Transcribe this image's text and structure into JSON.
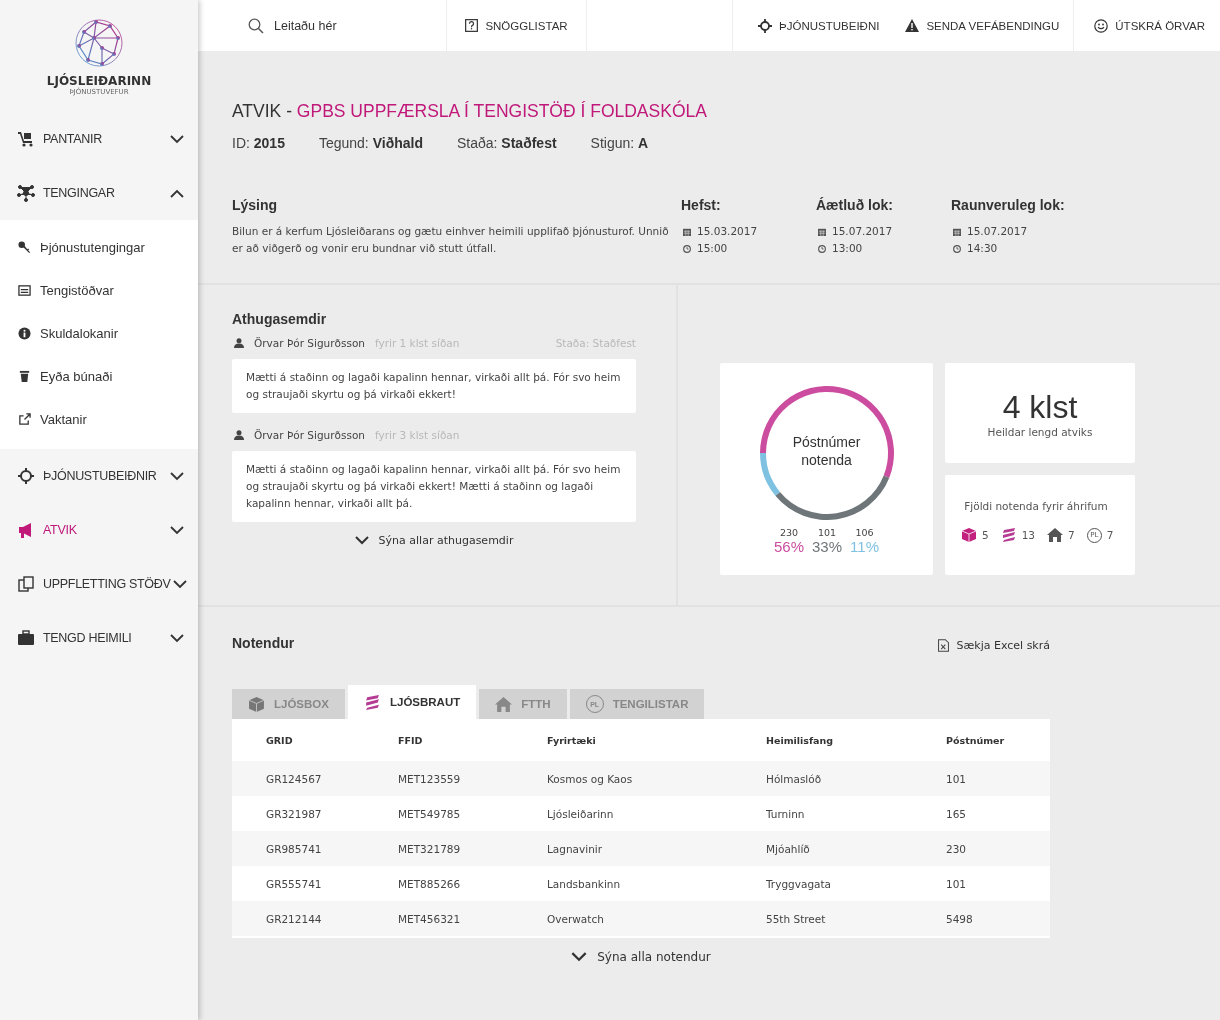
{
  "brand": {
    "name": "LJÓSLEIÐARINN",
    "subtitle": "ÞJÓNUSTUVEFUR"
  },
  "sidebar": {
    "items": [
      {
        "label": "PANTANIR",
        "expanded": false,
        "selected": false
      },
      {
        "label": "TENGINGAR",
        "expanded": true,
        "selected": false,
        "children": [
          {
            "label": "Þjónustutengingar"
          },
          {
            "label": "Tengistöðvar"
          },
          {
            "label": "Skuldalokanir"
          },
          {
            "label": "Eyða búnaði"
          },
          {
            "label": "Vaktanir"
          }
        ]
      },
      {
        "label": "ÞJÓNUSTUBEIÐNIR",
        "expanded": false,
        "selected": false
      },
      {
        "label": "ATVIK",
        "expanded": false,
        "selected": true
      },
      {
        "label": "UPPFLETTING STÖÐV",
        "expanded": false,
        "selected": false
      },
      {
        "label": "TENGD HEIMILI",
        "expanded": false,
        "selected": false
      }
    ]
  },
  "topbar": {
    "search": {
      "placeholder": "Leitaðu hér"
    },
    "quick": "SNÖGGLISTAR",
    "actions": [
      "ÞJÓNUSTUBEIÐNI",
      "SENDA VEFÁBENDINGU"
    ],
    "logout": "ÚTSKRÁ ÖRVAR"
  },
  "incident": {
    "prefix": "ATVIK -",
    "title": "GPBS UPPFÆRSLA Í TENGISTÖÐ Í FOLDASKÓLA",
    "meta": [
      {
        "label": "ID:",
        "value": "2015"
      },
      {
        "label": "Tegund:",
        "value": "Viðhald"
      },
      {
        "label": "Staða:",
        "value": "Staðfest"
      },
      {
        "label": "Stigun:",
        "value": "A"
      }
    ],
    "description": {
      "heading": "Lýsing",
      "text": "Bilun er á kerfum Ljósleiðarans og gætu einhver heimili upplifað þjónusturof. Unnið er að viðgerð og vonir eru bundnar við stutt útfall."
    },
    "dates": [
      {
        "heading": "Hefst:",
        "date": "15.03.2017",
        "time": "15:00"
      },
      {
        "heading": "Áætluð lok:",
        "date": "15.07.2017",
        "time": "13:00"
      },
      {
        "heading": "Raunveruleg lok:",
        "date": "15.07.2017",
        "time": "14:30"
      }
    ]
  },
  "comments": {
    "heading": "Athugasemdir",
    "items": [
      {
        "author": "Örvar Þór Sigurðsson",
        "time": "fyrir 1 klst síðan",
        "status": "Staða: Staðfest",
        "text": "Mætti á staðinn og lagaði kapalinn hennar, virkaði allt þá. Fór svo heim og straujaði skyrtu og þá virkaði ekkert!"
      },
      {
        "author": "Örvar Þór Sigurðsson",
        "time": "fyrir 3 klst síðan",
        "text": "Mætti á staðinn og lagaði kapalinn hennar, virkaði allt þá. Fór svo heim og straujaði skyrtu og þá virkaði ekkert! Mætti á staðinn og lagaði kapalinn hennar, virkaði allt þá."
      }
    ],
    "show_all": "Sýna allar athugasemdir"
  },
  "postcodes": {
    "chart_data": {
      "type": "donut",
      "title": "Póstnúmer notenda",
      "categories": [
        "230",
        "101",
        "106"
      ],
      "series": [
        {
          "values": [
            56,
            33,
            11
          ],
          "colors": [
            "#cc4d9f",
            "#6f7679",
            "#7fc1e0"
          ]
        }
      ],
      "value_labels": [
        "56%",
        "33%",
        "11%"
      ]
    }
  },
  "duration": {
    "value": "4 klst",
    "label": "Heildar lengd atviks"
  },
  "affected": {
    "label": "Fjöldi notenda fyrir áhrifum",
    "counts": [
      "5",
      "13",
      "7",
      "7"
    ],
    "pl_badge": "PL"
  },
  "users": {
    "heading": "Notendur",
    "export": "Sækja Excel skrá",
    "tabs": [
      {
        "label": "LJÓSBOX",
        "selected": false
      },
      {
        "label": "LJÓSBRAUT",
        "selected": true
      },
      {
        "label": "FTTH",
        "selected": false
      },
      {
        "label": "TENGILISTAR",
        "selected": false,
        "badge": "PL"
      }
    ],
    "columns": [
      "GRID",
      "FFID",
      "Fyrirtæki",
      "Heimilisfang",
      "Póstnúmer"
    ],
    "rows": [
      [
        "GR124567",
        "MET123559",
        "Kosmos og Kaos",
        "Hólmaslóð",
        "101"
      ],
      [
        "GR321987",
        "MET549785",
        "Ljósleiðarinn",
        "Turninn",
        "165"
      ],
      [
        "GR985741",
        "MET321789",
        "Lagnavinir",
        "Mjóahlíð",
        "230"
      ],
      [
        "GR555741",
        "MET885266",
        "Landsbankinn",
        "Tryggvagata",
        "101"
      ],
      [
        "GR212144",
        "MET456321",
        "Overwatch",
        "55th Street",
        "5498"
      ]
    ],
    "show_all": "Sýna alla notendur"
  }
}
